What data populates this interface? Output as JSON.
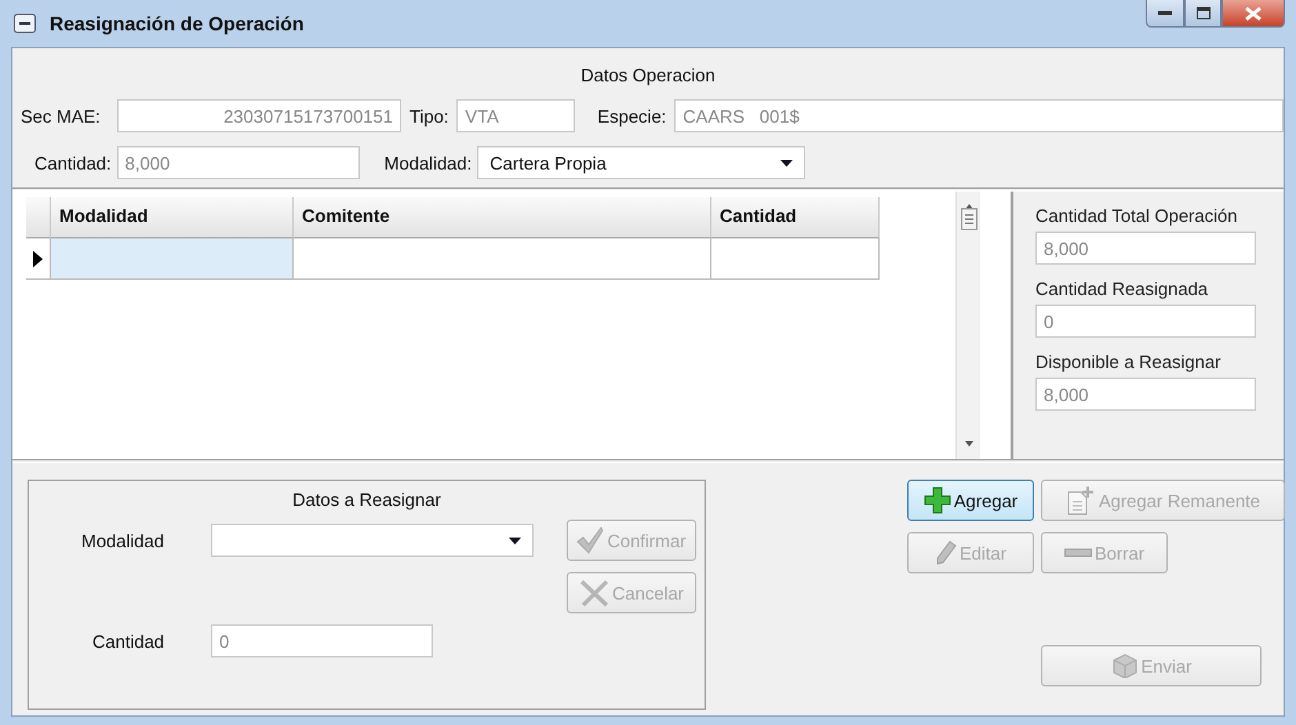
{
  "window": {
    "title": "Reasignación de Operación"
  },
  "operation": {
    "title": "Datos Operacion",
    "fields": [
      {
        "label": "Sec MAE:",
        "value": "23030715173700151"
      },
      {
        "label": "Tipo:",
        "value": "VTA"
      },
      {
        "label": "Especie:",
        "value": "CAARS   001$"
      },
      {
        "label": "Cantidad:",
        "value": "8,000"
      }
    ],
    "modalidad": {
      "label": "Modalidad:",
      "value": "Cartera Propia"
    }
  },
  "grid": {
    "columns": [
      "Modalidad",
      "Comitente",
      "Cantidad"
    ],
    "rows": [
      {
        "selected": true
      }
    ]
  },
  "totals": [
    {
      "label": "Cantidad Total Operación",
      "value": "8,000"
    },
    {
      "label": "Cantidad Reasignada",
      "value": "0"
    },
    {
      "label": "Disponible a Reasignar",
      "value": "8,000"
    }
  ],
  "reassign": {
    "title": "Datos a Reasignar",
    "modalidad_label": "Modalidad",
    "cantidad_label": "Cantidad",
    "cantidad_value": "0",
    "buttons": [
      {
        "label": "Confirmar",
        "disabled": true
      },
      {
        "label": "Cancelar",
        "disabled": true
      }
    ]
  },
  "actions": [
    {
      "label": "Agregar",
      "disabled": false,
      "focused": true
    },
    {
      "label": "Agregar Remanente",
      "disabled": true,
      "focused": false
    },
    {
      "label": "Editar",
      "disabled": true,
      "focused": false
    },
    {
      "label": "Borrar",
      "disabled": true,
      "focused": false
    },
    {
      "label": "Enviar",
      "disabled": true,
      "focused": false
    }
  ]
}
